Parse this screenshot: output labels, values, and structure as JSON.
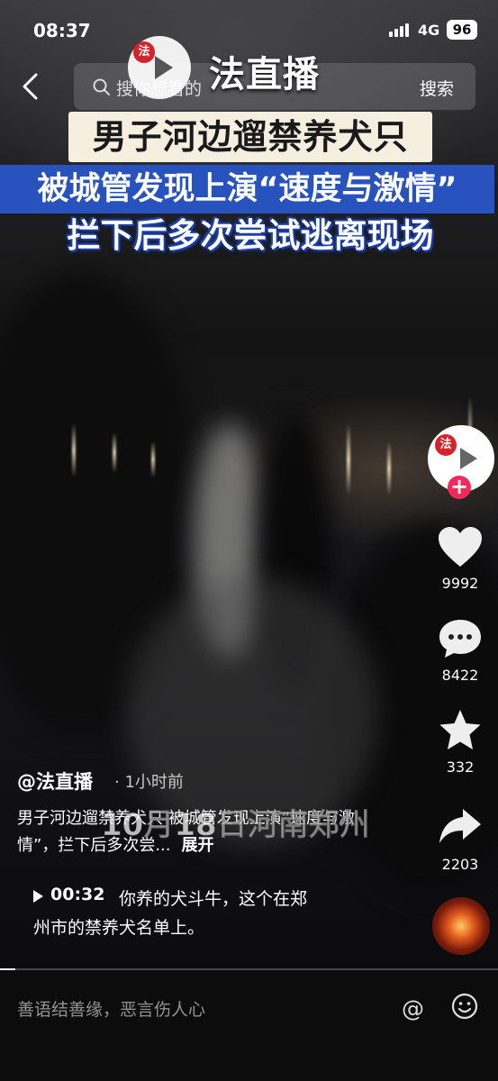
{
  "status_bar": {
    "time": "08:37",
    "network": "4G",
    "battery": "96"
  },
  "search": {
    "placeholder": "搜你想看的",
    "button": "搜索"
  },
  "watermark": {
    "brand": "法直播",
    "date_location": "10月18日河南郑州"
  },
  "headline": {
    "line1": "男子河边遛禁养犬只",
    "line2": "被城管发现上演“速度与激情”",
    "line3": "拦下后多次尝试逃离现场"
  },
  "rail": {
    "likes": "9992",
    "comments": "8422",
    "favorites": "332",
    "shares": "2203"
  },
  "post": {
    "author": "@法直播",
    "time_ago": "· 1小时前",
    "description": "男子河边遛禁养犬只 被城管发现上演“速度与激情”，拦下后多次尝...",
    "expand": "展开"
  },
  "comment_preview": {
    "timestamp": "00:32",
    "text_line1": "你养的犬斗牛，这个在郑",
    "text_line2": "州市的禁养犬名单上。"
  },
  "playback_progress": 0.03,
  "input": {
    "placeholder": "善语结善缘，恶言伤人心"
  },
  "colors": {
    "follow_accent": "#f2295b",
    "brand_red": "#d8222b",
    "banner_blue": "#2852bd",
    "banner_cream": "#f6efe0"
  }
}
